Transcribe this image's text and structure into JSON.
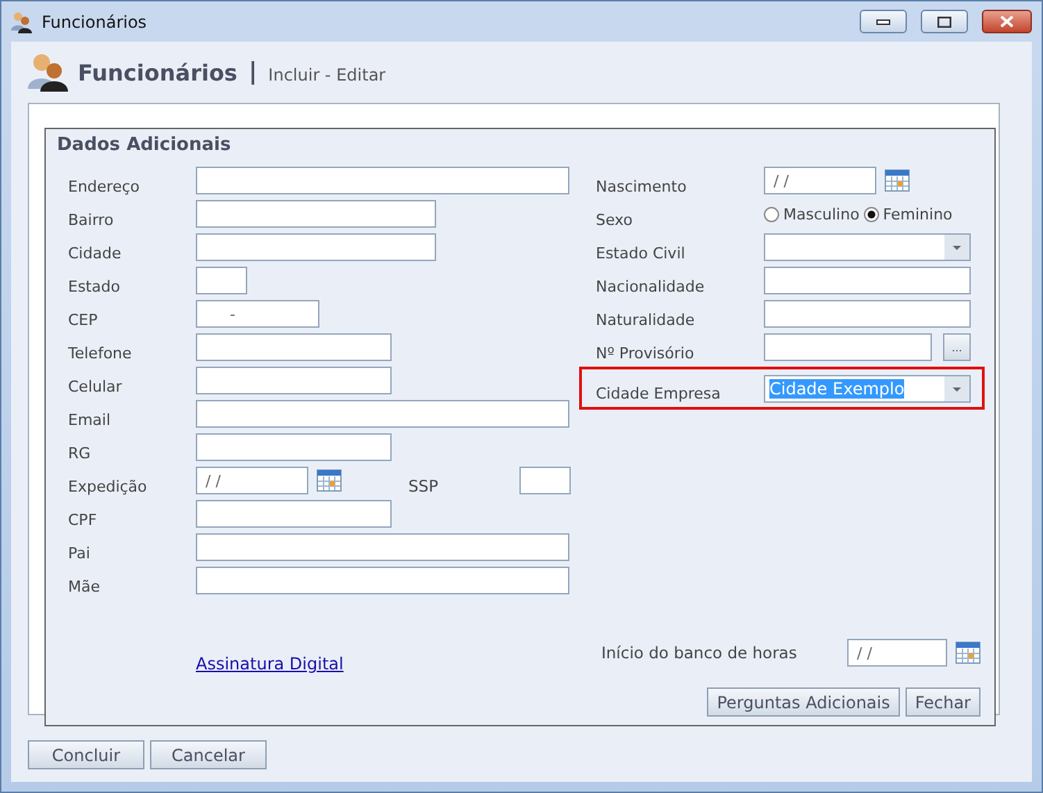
{
  "window": {
    "title": "Funcionários"
  },
  "header": {
    "title": "Funcionários",
    "separator": "|",
    "subtitle": "Incluir - Editar"
  },
  "panel": {
    "title": "Dados Adicionais",
    "left_fields": [
      {
        "label": "Endereço",
        "kind": "text"
      },
      {
        "label": "Bairro",
        "kind": "text"
      },
      {
        "label": "Cidade",
        "kind": "text"
      },
      {
        "label": "Estado",
        "kind": "text"
      },
      {
        "label": "CEP",
        "kind": "text",
        "value": "     -"
      },
      {
        "label": "Telefone",
        "kind": "text"
      },
      {
        "label": "Celular",
        "kind": "text"
      },
      {
        "label": "Email",
        "kind": "text"
      },
      {
        "label": "RG",
        "kind": "text"
      },
      {
        "label": "Expedição",
        "kind": "date",
        "value": "/ /",
        "side_label": "SSP"
      },
      {
        "label": "CPF",
        "kind": "text"
      },
      {
        "label": "Pai",
        "kind": "text"
      },
      {
        "label": "Mãe",
        "kind": "text"
      }
    ],
    "right_fields": [
      {
        "label": "Nascimento",
        "kind": "date",
        "value": "/ /"
      },
      {
        "label": "Sexo",
        "kind": "radio",
        "options": [
          {
            "label": "Masculino",
            "selected": false
          },
          {
            "label": "Feminino",
            "selected": true
          }
        ]
      },
      {
        "label": "Estado Civil",
        "kind": "combo"
      },
      {
        "label": "Nacionalidade",
        "kind": "text"
      },
      {
        "label": "Naturalidade",
        "kind": "text"
      },
      {
        "label": "Nº Provisório",
        "kind": "lookup",
        "button": "..."
      },
      {
        "label": "Cidade Empresa",
        "kind": "combo",
        "value": "Cidade Exemplo",
        "text_selected": true,
        "highlighted": true
      }
    ],
    "link": "Assinatura Digital",
    "bank_hours": {
      "label": "Início do banco de horas",
      "value": "/ /"
    },
    "buttons": [
      "Perguntas Adicionais",
      "Fechar"
    ]
  },
  "footer_buttons": [
    "Concluir",
    "Cancelar"
  ]
}
